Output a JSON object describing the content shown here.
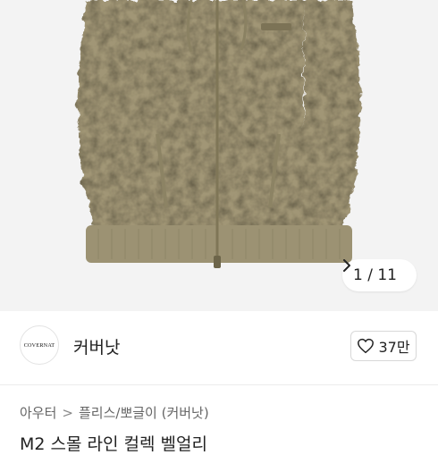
{
  "gallery": {
    "current": "1",
    "total": "11",
    "counter_text": "1 / 11",
    "next_icon": "chevron-right-icon",
    "jacket_color": "#a19676"
  },
  "brand": {
    "logo_text": "COVERNAT",
    "name": "커버낫",
    "likes_icon": "heart-outline-icon",
    "likes": "37만"
  },
  "breadcrumb": {
    "items": [
      "아우터",
      "플리스/뽀글이 (커버낫)"
    ],
    "separator": ">"
  },
  "product": {
    "title": "M2 스몰 라인 컬렉 벨얼리"
  }
}
